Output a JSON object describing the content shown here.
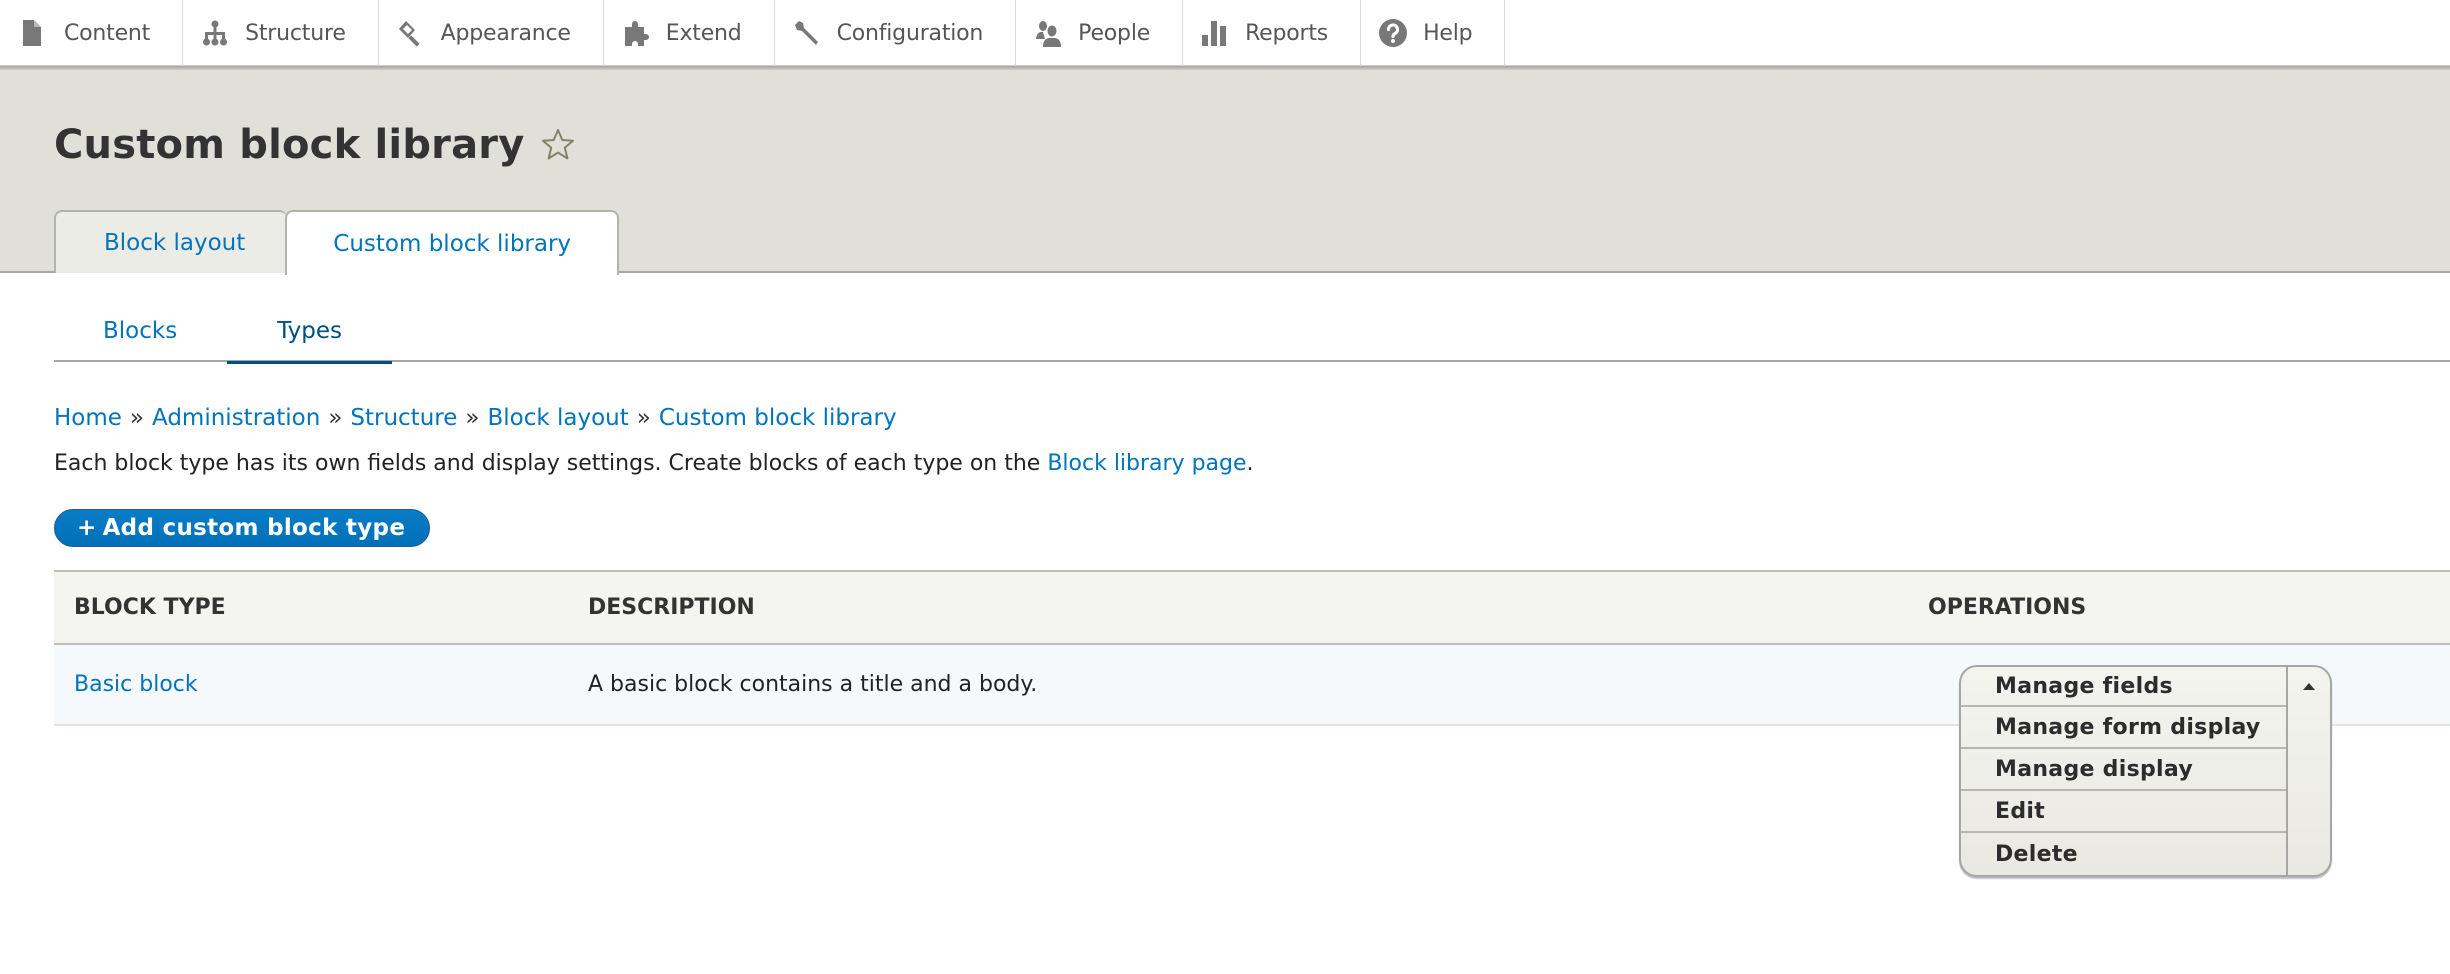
{
  "toolbar": {
    "items": [
      {
        "label": "Content",
        "icon": "file-icon"
      },
      {
        "label": "Structure",
        "icon": "sitemap-icon"
      },
      {
        "label": "Appearance",
        "icon": "paintbrush-icon"
      },
      {
        "label": "Extend",
        "icon": "puzzle-icon"
      },
      {
        "label": "Configuration",
        "icon": "wrench-icon"
      },
      {
        "label": "People",
        "icon": "people-icon"
      },
      {
        "label": "Reports",
        "icon": "bar-chart-icon"
      },
      {
        "label": "Help",
        "icon": "question-icon"
      }
    ]
  },
  "header": {
    "title": "Custom block library",
    "shortcut_icon": "star-outline-icon",
    "primary_tabs": [
      {
        "label": "Block layout",
        "active": false
      },
      {
        "label": "Custom block library",
        "active": true
      }
    ]
  },
  "secondary_tabs": [
    {
      "label": "Blocks",
      "active": false
    },
    {
      "label": "Types",
      "active": true
    }
  ],
  "breadcrumb": {
    "separator": "»",
    "items": [
      "Home",
      "Administration",
      "Structure",
      "Block layout",
      "Custom block library"
    ]
  },
  "help": {
    "text_before": "Each block type has its own fields and display settings. Create blocks of each type on the ",
    "link": "Block library page",
    "text_after": "."
  },
  "actions": {
    "add_plus": "+",
    "add_label": "Add custom block type"
  },
  "table": {
    "headers": [
      "BLOCK TYPE",
      "DESCRIPTION",
      "OPERATIONS"
    ],
    "rows": [
      {
        "block_type": "Basic block",
        "description": "A basic block contains a title and a body.",
        "operations": [
          "Manage fields",
          "Manage form display",
          "Manage display",
          "Edit",
          "Delete"
        ],
        "dropdown_expanded": true
      }
    ]
  },
  "colors": {
    "link": "#0074bd",
    "active_tab": "#004f80",
    "header_band": "#e0e0d8",
    "primary_button": "#0074bd"
  }
}
